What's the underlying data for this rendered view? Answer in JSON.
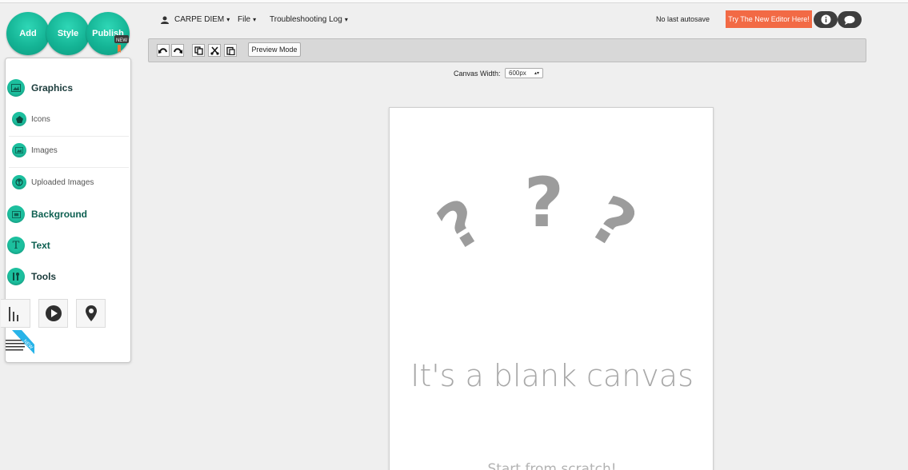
{
  "header": {
    "add_label": "Add",
    "style_label": "Style",
    "publish_label": "Publish",
    "new_badge": "NEW",
    "account_name": "CARPE DIEM",
    "file_menu": "File",
    "troubleshooting_menu": "Troubleshooting Log",
    "autosave_status": "No last autosave",
    "try_editor_label": "Try The New Editor Here!"
  },
  "toolbar": {
    "icons": [
      "undo-icon",
      "redo-icon",
      "copy-icon",
      "cut-icon",
      "paste-icon"
    ],
    "preview_label": "Preview Mode"
  },
  "canvas_width": {
    "label": "Canvas Width:",
    "value": "600px"
  },
  "sidebar": {
    "graphics": {
      "label": "Graphics",
      "items": [
        "Icons",
        "Images",
        "Uploaded Images"
      ]
    },
    "background": "Background",
    "text": "Text",
    "tools": "Tools",
    "tool_icons": [
      "bar-chart-icon",
      "play-icon",
      "map-pin-icon",
      "lines-icon"
    ],
    "new_badge": "NEW"
  },
  "canvas": {
    "title": "It's a blank canvas",
    "subtitle": "Start from scratch!"
  },
  "colors": {
    "accent": "#15b596",
    "try_button": "#f26a45",
    "background": "#efefef"
  }
}
